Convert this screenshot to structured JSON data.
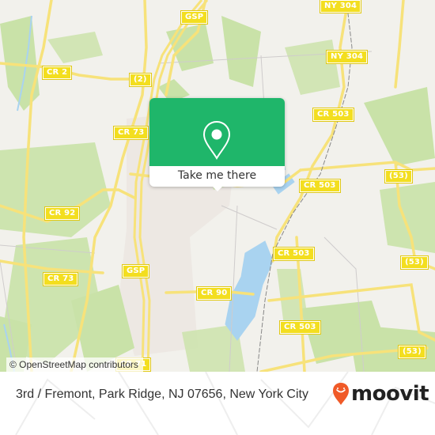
{
  "map": {
    "popup": {
      "action_label": "Take me there",
      "accent_color": "#1fb66a",
      "icon": "location-pin-icon"
    },
    "attribution": "© OpenStreetMap contributors",
    "road_labels": [
      {
        "id": "gsp-north",
        "text": "GSP"
      },
      {
        "id": "ny304-north",
        "text": "NY 304"
      },
      {
        "id": "ny304-mid",
        "text": "NY 304"
      },
      {
        "id": "cr2",
        "text": "CR 2"
      },
      {
        "id": "route2",
        "text": "(2)"
      },
      {
        "id": "cr73-north",
        "text": "CR 73"
      },
      {
        "id": "cr503-north",
        "text": "CR 503"
      },
      {
        "id": "cr503-mid",
        "text": "CR 503"
      },
      {
        "id": "route53-north",
        "text": "(53)"
      },
      {
        "id": "cr92",
        "text": "CR 92"
      },
      {
        "id": "cr503-lake",
        "text": "CR 503"
      },
      {
        "id": "route53-mid",
        "text": "(53)"
      },
      {
        "id": "gsp-south",
        "text": "GSP"
      },
      {
        "id": "cr73-south",
        "text": "CR 73"
      },
      {
        "id": "cr90",
        "text": "CR 90"
      },
      {
        "id": "cr503-south",
        "text": "CR 503"
      },
      {
        "id": "route53-south",
        "text": "(53)"
      },
      {
        "id": "cr71",
        "text": "CR 71"
      }
    ],
    "colors": {
      "land": "#f2f1ec",
      "park": "#c9e2a8",
      "water": "#a9d3f0",
      "road": "#f7e27a",
      "shield": "#f3de1f"
    }
  },
  "footer": {
    "address": "3rd / Fremont, Park Ridge, NJ 07656, New York City",
    "brand": "moovit",
    "brand_color": "#f05a28",
    "brand_icon": "moovit-smile-pin-icon"
  }
}
